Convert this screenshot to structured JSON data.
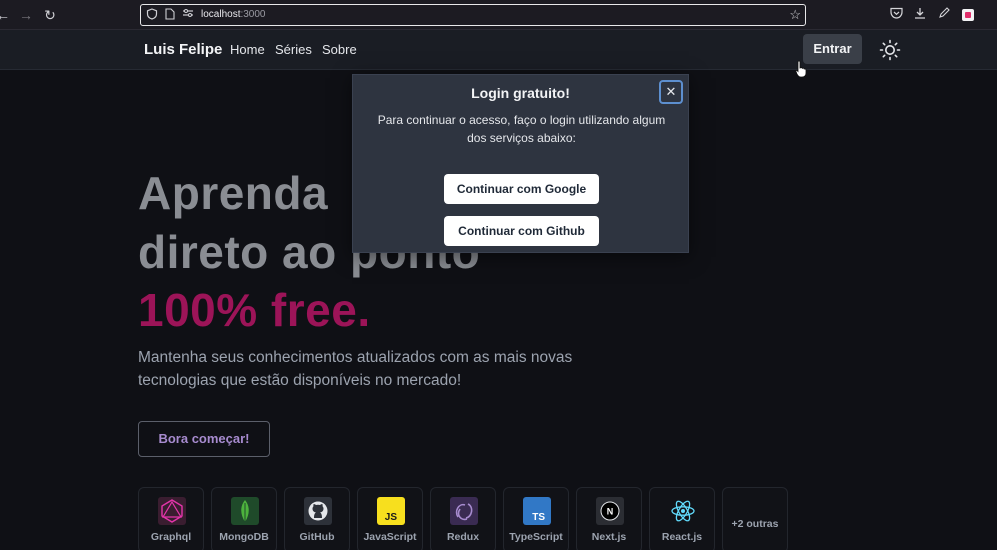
{
  "browser": {
    "url_host": "localhost",
    "url_port": ":3000",
    "icons": [
      "back-icon",
      "forward-icon",
      "reload-icon",
      "shield-icon",
      "page-icon",
      "permissions-icon",
      "bookmark-star-icon",
      "pocket-icon",
      "download-icon",
      "pen-icon",
      "extension-icon"
    ]
  },
  "header": {
    "brand": "Luis Felipe",
    "nav": [
      "Home",
      "Séries",
      "Sobre"
    ],
    "login_label": "Entrar"
  },
  "hero": {
    "line1": "Aprenda",
    "line2": "direto ao ponto",
    "line3": "100% free.",
    "subtitle": "Mantenha seus conhecimentos atualizados com as mais novas tecnologias que estão disponíveis no mercado!",
    "cta_label": "Bora começar!"
  },
  "techs": [
    {
      "name": "Graphql",
      "icon": "graphql-icon",
      "color": "#e535ab"
    },
    {
      "name": "MongoDB",
      "icon": "mongodb-icon",
      "color": "#4db33d"
    },
    {
      "name": "GitHub",
      "icon": "github-icon",
      "color": "#e5e7eb"
    },
    {
      "name": "JavaScript",
      "icon": "javascript-icon",
      "color": "#f7df1e"
    },
    {
      "name": "Redux",
      "icon": "redux-icon",
      "color": "#764abc"
    },
    {
      "name": "TypeScript",
      "icon": "typescript-icon",
      "color": "#3178c6"
    },
    {
      "name": "Next.js",
      "icon": "nextjs-icon",
      "color": "#ffffff"
    },
    {
      "name": "React.js",
      "icon": "react-icon",
      "color": "#61dafb"
    }
  ],
  "techs_more": "+2 outras",
  "modal": {
    "title": "Login gratuito!",
    "text": "Para continuar o acesso, faço o login utilizando algum dos serviços abaixo:",
    "google_label": "Continuar com Google",
    "github_label": "Continuar com Github",
    "close_icon": "close-icon"
  },
  "colors": {
    "accent_pink": "#9c1458",
    "modal_bg": "#2e3440",
    "page_bg": "#0f1015"
  }
}
